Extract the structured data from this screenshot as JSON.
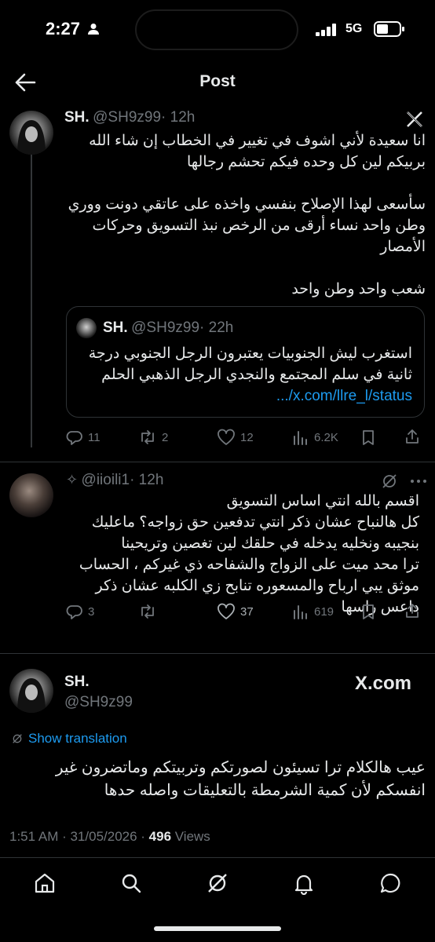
{
  "status_bar": {
    "time": "2:27",
    "network": "5G"
  },
  "header": {
    "title": "Post"
  },
  "post1": {
    "name": "SH.",
    "handle": "@SH9z99",
    "time": "· 12h",
    "lines": [
      "انا سعيدة لأني اشوف في تغيير في الخطاب إن شاء الله",
      "بربيكم لين كل وحده فيكم تحشم رجالها",
      "سأسعى لهذا الإصلاح بنفسي واخذه على عاتقي دونت ووري",
      "وطن واحد نساء أرقى من الرخص نبذ التسويق وحركات",
      "الأمصار",
      "شعب واحد وطن واحد"
    ],
    "quote": {
      "name": "SH.",
      "handle": "@SH9z99",
      "time": "· 22h",
      "lines": [
        "استغرب ليش الجنوبيات يعتبرون الرجل الجنوبي درجة",
        "ثانية في سلم المجتمع والنجدي الرجل الذهبي الحلم"
      ],
      "link": ".../x.com/llre_l/status"
    },
    "actions": {
      "replies": "11",
      "reposts": "2",
      "likes": "12",
      "views": "6.2K"
    }
  },
  "post2": {
    "handle": "@iioili1",
    "time": "· 12h",
    "lines": [
      "اقسم بالله انتي اساس التسويق",
      "كل هالنباح عشان ذكر انتي تدفعين حق زواجه؟ ماعليك",
      "بنجيبه ونخليه يدخله في حلقك لين تغصين وتريحينا",
      "ترا محد ميت على الزواج والشفاحه ذي غيركم ، الحساب",
      "موثق يبي ارباح والمسعوره تنابح زي الكلبه عشان ذكر",
      "داعس راسها"
    ],
    "actions": {
      "replies": "3",
      "reposts": "",
      "likes": "37",
      "views": "619"
    }
  },
  "main_post": {
    "name": "SH.",
    "handle": "@SH9z99",
    "badge": "X.com",
    "translate": "Show translation",
    "lines": [
      "عيب هالكلام ترا تسيئون لصورتكم وتربيتكم وماتضرون غير",
      "انفسكم لأن كمية الشرمطة بالتعليقات واصله حدها"
    ],
    "timestamp": "1:51 AM · 31/05/2026 · ",
    "views_count": "496",
    "views_label": " Views"
  },
  "icons": [
    "back-arrow-icon",
    "x-logo-icon",
    "grok-icon",
    "home-icon",
    "search-icon",
    "bell-icon",
    "message-icon"
  ]
}
